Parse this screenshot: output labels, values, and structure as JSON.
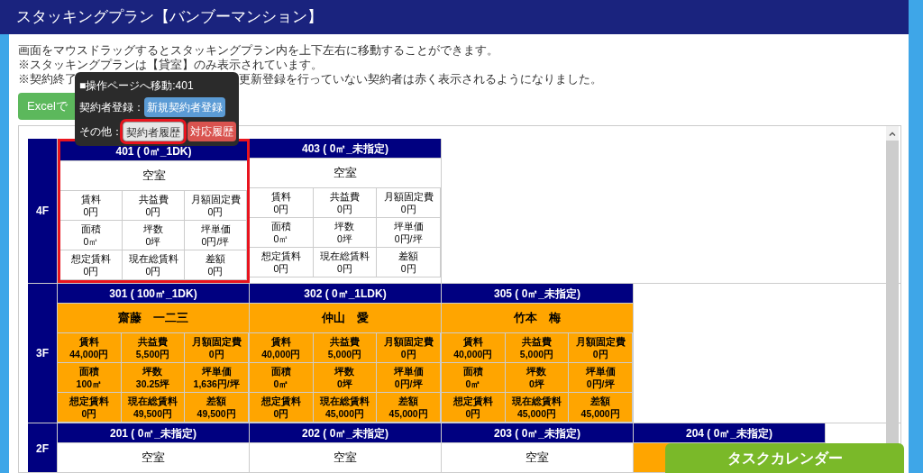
{
  "header": {
    "title": "スタッキングプラン【バンブーマンション】"
  },
  "notes": [
    {
      "parts": [
        "画面をマウスドラッグするとスタッキングプラン内を上下左右に移動することができます。"
      ]
    },
    {
      "parts": [
        "※スタッキングプランは【貸室】のみ表示されています。"
      ]
    },
    {
      "parts": [
        "※契約終了",
        "更新登録を行っていない契約者は赤く表示されるようになりました。"
      ]
    }
  ],
  "export_button": {
    "label": "Excelで"
  },
  "popup": {
    "title": "■操作ページへ移動:401",
    "rows": [
      {
        "label": "契約者登録：",
        "buttons": [
          {
            "label": "新規契約者登録",
            "kind": "primary",
            "highlighted": false
          }
        ]
      },
      {
        "label": "その他：",
        "buttons": [
          {
            "label": "契約者履歴",
            "kind": "default",
            "highlighted": true
          },
          {
            "label": "対応履歴",
            "kind": "danger",
            "highlighted": false
          }
        ]
      }
    ]
  },
  "floors": [
    {
      "label": "4F",
      "units": [
        {
          "title": "401 ( 0㎡_1DK)",
          "tenant": "空室",
          "occupied": false,
          "highlighted": true,
          "fields": [
            {
              "label": "賃料",
              "value": "0円"
            },
            {
              "label": "共益費",
              "value": "0円"
            },
            {
              "label": "月額固定費",
              "value": "0円"
            },
            {
              "label": "面積",
              "value": "0㎡"
            },
            {
              "label": "坪数",
              "value": "0坪"
            },
            {
              "label": "坪単価",
              "value": "0円/坪"
            },
            {
              "label": "想定賃料",
              "value": "0円"
            },
            {
              "label": "現在総賃料",
              "value": "0円"
            },
            {
              "label": "差額",
              "value": "0円"
            }
          ]
        },
        {
          "title": "403 ( 0㎡_未指定)",
          "tenant": "空室",
          "occupied": false,
          "highlighted": false,
          "fields": [
            {
              "label": "賃料",
              "value": "0円"
            },
            {
              "label": "共益費",
              "value": "0円"
            },
            {
              "label": "月額固定費",
              "value": "0円"
            },
            {
              "label": "面積",
              "value": "0㎡"
            },
            {
              "label": "坪数",
              "value": "0坪"
            },
            {
              "label": "坪単価",
              "value": "0円/坪"
            },
            {
              "label": "想定賃料",
              "value": "0円"
            },
            {
              "label": "現在総賃料",
              "value": "0円"
            },
            {
              "label": "差額",
              "value": "0円"
            }
          ]
        }
      ]
    },
    {
      "label": "3F",
      "units": [
        {
          "title": "301 ( 100㎡_1DK)",
          "tenant": "齋藤　一二三",
          "occupied": true,
          "highlighted": false,
          "fields": [
            {
              "label": "賃料",
              "value": "44,000円"
            },
            {
              "label": "共益費",
              "value": "5,500円"
            },
            {
              "label": "月額固定費",
              "value": "0円"
            },
            {
              "label": "面積",
              "value": "100㎡"
            },
            {
              "label": "坪数",
              "value": "30.25坪"
            },
            {
              "label": "坪単価",
              "value": "1,636円/坪"
            },
            {
              "label": "想定賃料",
              "value": "0円"
            },
            {
              "label": "現在総賃料",
              "value": "49,500円"
            },
            {
              "label": "差額",
              "value": "49,500円"
            }
          ]
        },
        {
          "title": "302 ( 0㎡_1LDK)",
          "tenant": "仲山　愛",
          "occupied": true,
          "highlighted": false,
          "fields": [
            {
              "label": "賃料",
              "value": "40,000円"
            },
            {
              "label": "共益費",
              "value": "5,000円"
            },
            {
              "label": "月額固定費",
              "value": "0円"
            },
            {
              "label": "面積",
              "value": "0㎡"
            },
            {
              "label": "坪数",
              "value": "0坪"
            },
            {
              "label": "坪単価",
              "value": "0円/坪"
            },
            {
              "label": "想定賃料",
              "value": "0円"
            },
            {
              "label": "現在総賃料",
              "value": "45,000円"
            },
            {
              "label": "差額",
              "value": "45,000円"
            }
          ]
        },
        {
          "title": "305 ( 0㎡_未指定)",
          "tenant": "竹本　梅",
          "occupied": true,
          "highlighted": false,
          "fields": [
            {
              "label": "賃料",
              "value": "40,000円"
            },
            {
              "label": "共益費",
              "value": "5,000円"
            },
            {
              "label": "月額固定費",
              "value": "0円"
            },
            {
              "label": "面積",
              "value": "0㎡"
            },
            {
              "label": "坪数",
              "value": "0坪"
            },
            {
              "label": "坪単価",
              "value": "0円/坪"
            },
            {
              "label": "想定賃料",
              "value": "0円"
            },
            {
              "label": "現在総賃料",
              "value": "45,000円"
            },
            {
              "label": "差額",
              "value": "45,000円"
            }
          ]
        }
      ]
    },
    {
      "label": "2F",
      "units": [
        {
          "title": "201 ( 0㎡_未指定)",
          "tenant": "空室",
          "occupied": false,
          "highlighted": false
        },
        {
          "title": "202 ( 0㎡_未指定)",
          "tenant": "空室",
          "occupied": false,
          "highlighted": false
        },
        {
          "title": "203 ( 0㎡_未指定)",
          "tenant": "空室",
          "occupied": false,
          "highlighted": false
        },
        {
          "title": "204 ( 0㎡_未指定)",
          "occupied": true,
          "highlighted": false
        }
      ]
    }
  ],
  "task_calendar": {
    "label": "タスクカレンダー"
  }
}
